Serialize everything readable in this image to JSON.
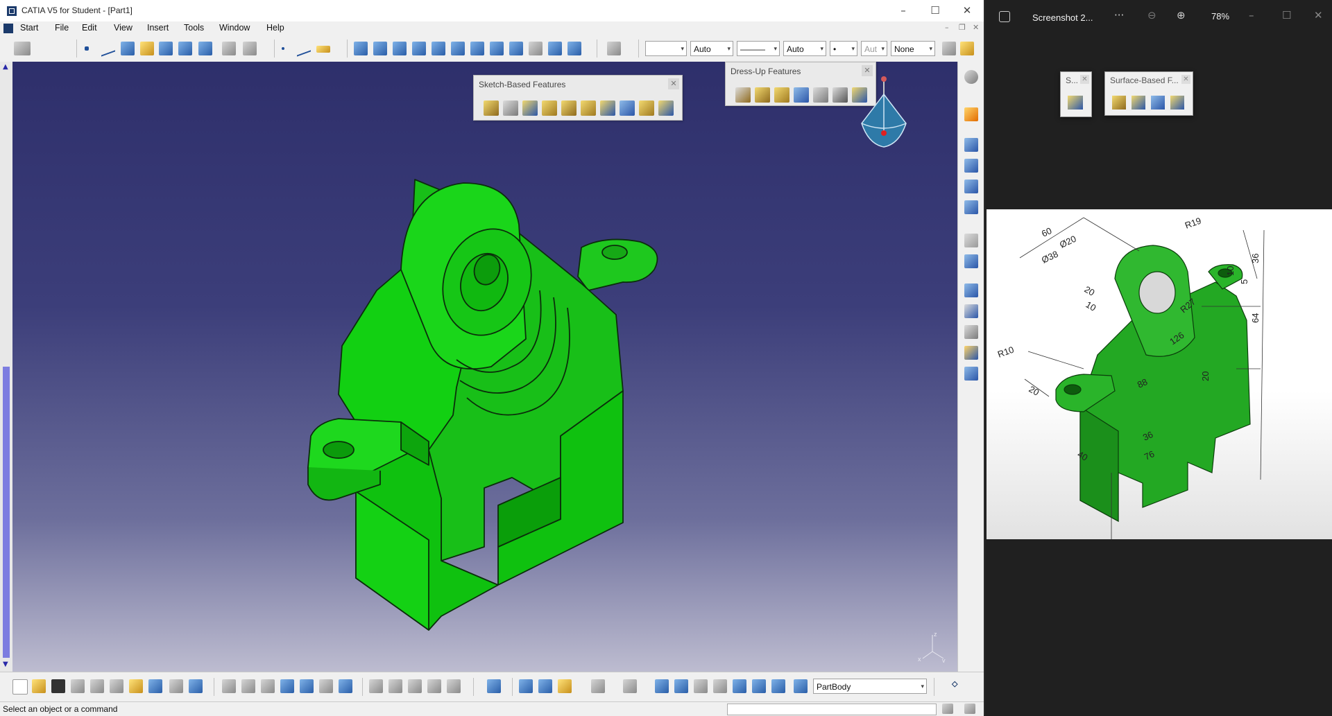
{
  "catia": {
    "title": "CATIA V5 for Student - [Part1]",
    "menus": [
      "Start",
      "File",
      "Edit",
      "View",
      "Insert",
      "Tools",
      "Window",
      "Help"
    ],
    "combos": {
      "color": "",
      "transparency": "Auto",
      "linetype": "———",
      "thickness": "Auto",
      "point": "•",
      "layer_short": "Aut",
      "layer": "None"
    },
    "toolbars": {
      "sketch_based": "Sketch-Based Features",
      "dress_up": "Dress-Up Features"
    },
    "part_body": "PartBody",
    "status": "Select an object or a command",
    "part_color": "#11d411",
    "view_axes": {
      "x": "x",
      "y": "y",
      "z": "z"
    }
  },
  "viewer": {
    "title": "Screenshot 2...",
    "more": "···",
    "zoom": "78%",
    "snip_small": "S...",
    "snip_surface": "Surface-Based F...",
    "dimensions": {
      "d60": "60",
      "dphi20": "Ø20",
      "dphi38": "Ø38",
      "r19": "R19",
      "d36a": "36",
      "d10a": "10",
      "d5": "5",
      "d20a": "20",
      "d10b": "10",
      "r27": "R27",
      "d64": "64",
      "r10": "R10",
      "d126": "126",
      "d20b": "20",
      "d88": "88",
      "d20c": "20",
      "d36b": "36",
      "d40": "40",
      "d76": "76"
    }
  }
}
